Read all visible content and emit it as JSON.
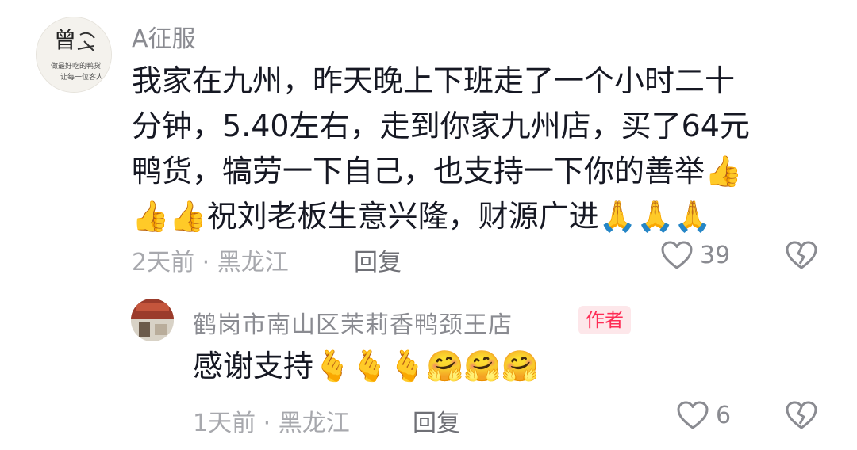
{
  "comment": {
    "username": "A征服",
    "lines": [
      "我家在九州，昨天晚上下班走了一个小时二十",
      "分钟，5.40左右，走到你家九州店，买了64元",
      "鸭货，犒劳一下自己，也支持一下你的善举",
      "祝刘老板生意兴隆，财源广进"
    ],
    "emoji": {
      "thumbs_up": "👍",
      "pray": "🙏"
    },
    "meta": "2天前 · 黑龙江",
    "reply_label": "回复",
    "like_count": "39"
  },
  "reply": {
    "username": "鹤岗市南山区茉莉香鸭颈王店",
    "author_badge": "作者",
    "text": "感谢支持",
    "emoji": {
      "heart_hand": "🫰",
      "hug": "🤗"
    },
    "meta": "1天前 · 黑龙江",
    "reply_label": "回复",
    "like_count": "6"
  },
  "avatar_main": {
    "big_char": "曾",
    "lines": [
      "做最好吃的鸭货",
      "让每一位客人"
    ]
  },
  "colors": {
    "text": "#161823",
    "meta": "#a7a8ad",
    "badge": "#fe2c55"
  },
  "icons": [
    "heart-outline-icon",
    "broken-heart-icon"
  ]
}
